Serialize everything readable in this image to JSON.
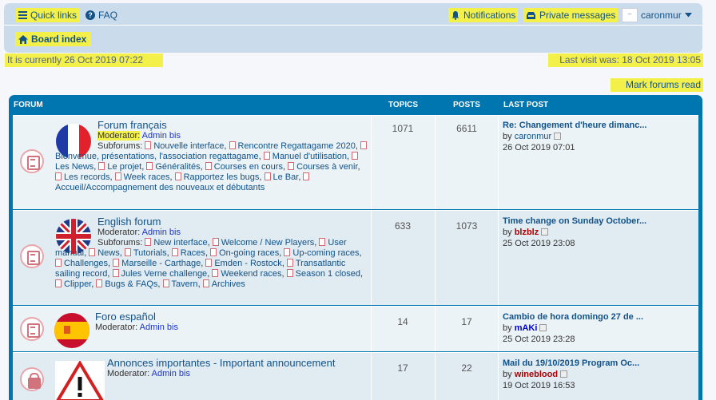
{
  "navbar": {
    "quick_links": "Quick links",
    "faq": "FAQ",
    "notifications": "Notifications",
    "private_messages": "Private messages",
    "username": "caronmur",
    "board_index": "Board index"
  },
  "info": {
    "current_time": "It is currently 26 Oct 2019 07:22",
    "last_visit": "Last visit was: 18 Oct 2019 13:05",
    "mark_read": "Mark forums read"
  },
  "table": {
    "col_forum": "FORUM",
    "col_topics": "TOPICS",
    "col_posts": "POSTS",
    "col_last_post": "LAST POST"
  },
  "forums": [
    {
      "title": "Forum français",
      "moderator_label": "Moderator:",
      "moderator": "Admin bis",
      "subforums_label": "Subforums:",
      "subforums": [
        "Nouvelle interface",
        "Rencontre Regattagame 2020",
        "Bienvenue, présentations, l'association regattagame",
        "Manuel d'utilisation",
        "Les News",
        "Le projet",
        "Généralités",
        "Courses en cours",
        "Courses à venir",
        "Les records",
        "Week races",
        "Rapportez les bugs",
        "Le Bar",
        "Accueil/Accompagnement des nouveaux et débutants"
      ],
      "topics": "1071",
      "posts": "6611",
      "last_title": "Re: Changement d'heure dimanc...",
      "last_by": "by",
      "last_user": "caronmur",
      "last_time": "26 Oct 2019 07:01"
    },
    {
      "title": "English forum",
      "moderator_label": "Moderator:",
      "moderator": "Admin bis",
      "subforums_label": "Subforums:",
      "subforums": [
        "New interface",
        "Welcome / New Players",
        "User manual",
        "News",
        "Tutorials",
        "Races",
        "On-going races",
        "Up-coming races",
        "Challenges",
        "Marseille - Carthage",
        "Emden - Rostock",
        "Transatlantic sailing record",
        "Jules Verne challenge",
        "Weekend races",
        "Season 1 closed",
        "Clipper",
        "Bugs & FAQs",
        "Tavern",
        "Archives"
      ],
      "topics": "633",
      "posts": "1073",
      "last_title": "Time change on Sunday October...",
      "last_by": "by",
      "last_user": "blzblz",
      "last_time": "25 Oct 2019 23:08"
    },
    {
      "title": "Foro español",
      "moderator_label": "Moderator:",
      "moderator": "Admin bis",
      "topics": "14",
      "posts": "17",
      "last_title": "Cambio de hora domingo 27 de ...",
      "last_by": "by",
      "last_user": "mAKi",
      "last_time": "25 Oct 2019 23:28"
    },
    {
      "title": "Annonces importantes - Important announcement",
      "moderator_label": "Moderator:",
      "moderator": "Admin bis",
      "topics": "17",
      "posts": "22",
      "last_title": "Mail du 19/10/2019 Program Oc...",
      "last_by": "by",
      "last_user": "wineblood",
      "last_time": "19 Oct 2019 16:53"
    }
  ]
}
